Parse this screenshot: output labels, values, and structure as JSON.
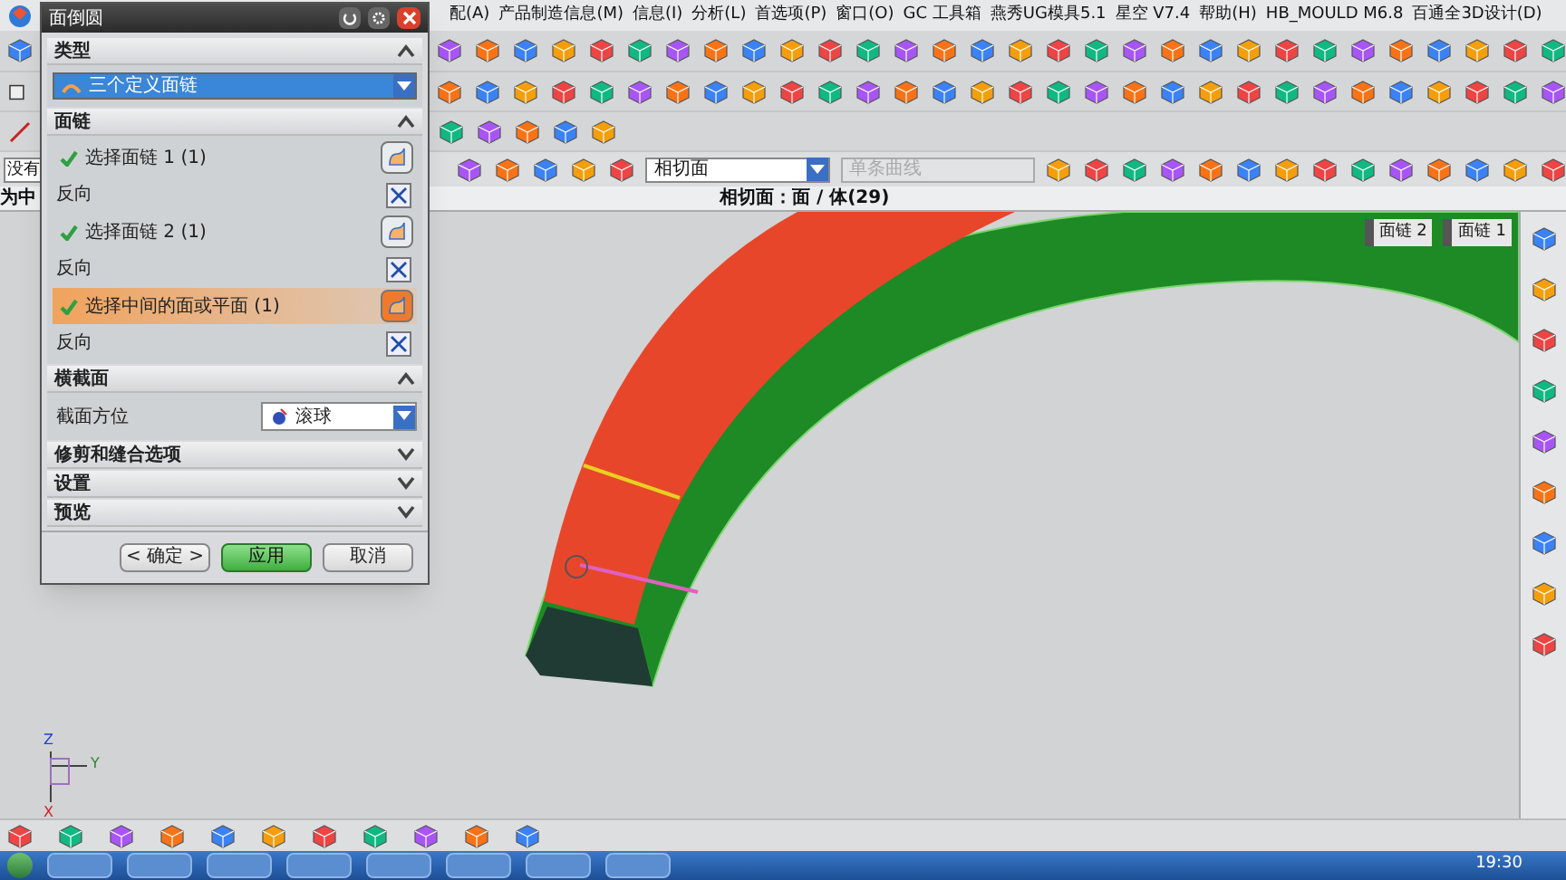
{
  "menu_bar": {
    "items": [
      "配(A)",
      "产品制造信息(M)",
      "信息(I)",
      "分析(L)",
      "首选项(P)",
      "窗口(O)",
      "GC 工具箱",
      "燕秀UG模具5.1",
      "星空 V7.4",
      "帮助(H)",
      "HB_MOULD M6.8",
      "百通全3D设计(D)"
    ]
  },
  "selection_bar": {
    "filter": "没有",
    "face_rule": "相切面",
    "curve_rule": {
      "value": "单条曲线",
      "disabled": true
    }
  },
  "status_line": {
    "prompt": "为中",
    "text": "相切面：面 / 体(29)"
  },
  "viewport": {
    "tags": [
      "面链 2",
      "面链 1"
    ],
    "axis_labels": [
      "Z",
      "Y",
      "X"
    ]
  },
  "dialog": {
    "title": "面倒圆",
    "sections": [
      {
        "title": "类型",
        "expanded": true,
        "rows": [
          {
            "kind": "dropdown",
            "value": "三个定义面链"
          }
        ]
      },
      {
        "title": "面链",
        "expanded": true,
        "rows": [
          {
            "kind": "select",
            "label": "选择面链 1 (1)",
            "done": true,
            "selected": false
          },
          {
            "kind": "reverse",
            "label": "反向"
          },
          {
            "kind": "select",
            "label": "选择面链 2 (1)",
            "done": true,
            "selected": false
          },
          {
            "kind": "reverse",
            "label": "反向"
          },
          {
            "kind": "select",
            "label": "选择中间的面或平面 (1)",
            "done": true,
            "selected": true
          },
          {
            "kind": "reverse",
            "label": "反向"
          }
        ]
      },
      {
        "title": "横截面",
        "expanded": true,
        "rows": [
          {
            "kind": "labeled_dropdown",
            "label": "截面方位",
            "value": "滚球"
          }
        ]
      },
      {
        "title": "修剪和缝合选项",
        "expanded": false
      },
      {
        "title": "设置",
        "expanded": false
      },
      {
        "title": "预览",
        "expanded": false
      }
    ],
    "buttons": [
      {
        "label": "< 确定 >",
        "primary": false
      },
      {
        "label": "应用",
        "primary": true
      },
      {
        "label": "取消",
        "primary": false
      }
    ]
  },
  "taskbar": {
    "time": "19:30"
  }
}
